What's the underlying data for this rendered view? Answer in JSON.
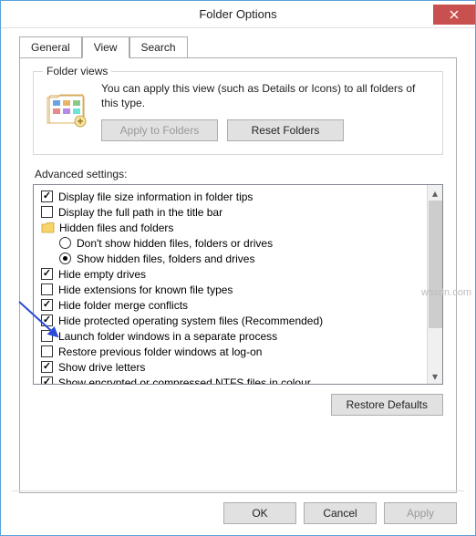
{
  "window": {
    "title": "Folder Options"
  },
  "tabs": {
    "general": "General",
    "view": "View",
    "search": "Search"
  },
  "folder_views": {
    "legend": "Folder views",
    "description": "You can apply this view (such as Details or Icons) to all folders of this type.",
    "apply_btn": "Apply to Folders",
    "reset_btn": "Reset Folders"
  },
  "advanced": {
    "label": "Advanced settings:",
    "items": [
      {
        "kind": "check",
        "checked": true,
        "label": "Display file size information in folder tips"
      },
      {
        "kind": "check",
        "checked": false,
        "label": "Display the full path in the title bar"
      },
      {
        "kind": "group",
        "label": "Hidden files and folders"
      },
      {
        "kind": "radio",
        "checked": false,
        "label": "Don't show hidden files, folders or drives"
      },
      {
        "kind": "radio",
        "checked": true,
        "label": "Show hidden files, folders and drives"
      },
      {
        "kind": "check",
        "checked": true,
        "label": "Hide empty drives"
      },
      {
        "kind": "check",
        "checked": false,
        "label": "Hide extensions for known file types"
      },
      {
        "kind": "check",
        "checked": true,
        "label": "Hide folder merge conflicts"
      },
      {
        "kind": "check",
        "checked": true,
        "label": "Hide protected operating system files (Recommended)"
      },
      {
        "kind": "check",
        "checked": false,
        "label": "Launch folder windows in a separate process"
      },
      {
        "kind": "check",
        "checked": false,
        "label": "Restore previous folder windows at log-on"
      },
      {
        "kind": "check",
        "checked": true,
        "label": "Show drive letters"
      },
      {
        "kind": "check",
        "checked": true,
        "label": "Show encrypted or compressed NTFS files in colour"
      }
    ],
    "restore_btn": "Restore Defaults"
  },
  "buttons": {
    "ok": "OK",
    "cancel": "Cancel",
    "apply": "Apply"
  },
  "watermark": "wsxdn.com"
}
